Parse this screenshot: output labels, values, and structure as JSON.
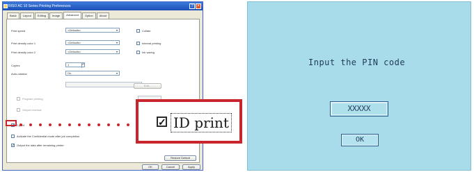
{
  "window": {
    "title": "RISO AC 10 Series Printing Preferences",
    "tabs": [
      "Basic",
      "Layout",
      "Editing",
      "Image",
      "Advanced",
      "Option",
      "About"
    ],
    "active_tab": "Advanced"
  },
  "advanced": {
    "print_speed": {
      "label": "Print speed",
      "value": "<Defaults>"
    },
    "print_density_1": {
      "label": "Print density color 1",
      "value": "<Defaults>"
    },
    "print_density_2": {
      "label": "Print density color 2",
      "value": "<Defaults>"
    },
    "copies": {
      "label": "Copies",
      "value": "1"
    },
    "auto_rotation": {
      "label": "Auto-rotation",
      "value": "On"
    },
    "edit_button": "Edit...",
    "program_printing": "Program printing",
    "output_reversal": "Output reversal",
    "id_print": {
      "label": "ID print",
      "checked": true
    },
    "activate_confidential": "Activate the Confidential mode after job completion",
    "output_after_printing": "Output the data after remaining printer",
    "right_checks": [
      "Collate",
      "Interval printing",
      "Ink saving"
    ],
    "restore_default": "Restore Default",
    "buttons": {
      "ok": "OK",
      "cancel": "Cancel",
      "apply": "Apply"
    }
  },
  "callout": {
    "label": "ID print",
    "checked": true,
    "accent_color": "#c9252d"
  },
  "pin_screen": {
    "prompt": "Input the PIN code",
    "masked_value": "XXXXX",
    "ok_label": "OK",
    "background_color": "#a8dcea"
  }
}
